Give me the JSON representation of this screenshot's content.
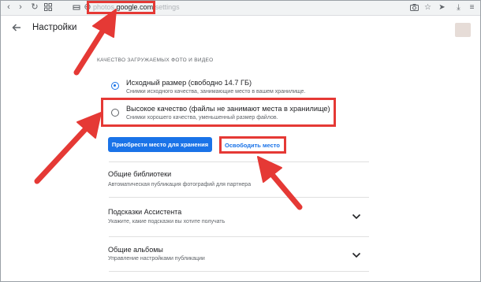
{
  "browser": {
    "url_host_prefix": "photos.",
    "url_domain": "google.com",
    "url_path": "/settings"
  },
  "header": {
    "title": "Настройки"
  },
  "upload_quality": {
    "section_title": "Качество загружаемых фото и видео",
    "options": [
      {
        "label": "Исходный размер (свободно 14.7 ГБ)",
        "description": "Снимки исходного качества, занимающие место в вашем хранилище.",
        "selected": true
      },
      {
        "label": "Высокое качество (файлы не занимают места в хранилище)",
        "description": "Снимки хорошего качества, уменьшенный размер файлов.",
        "selected": false
      }
    ],
    "buy_storage_label": "Приобрести место для хранения",
    "free_up_label": "Освободить место"
  },
  "settings_items": [
    {
      "title": "Общие библиотеки",
      "description": "Автоматическая публикация фотографий для партнера",
      "expandable": false
    },
    {
      "title": "Подсказки Ассистента",
      "description": "Укажите, какие подсказки вы хотите получать",
      "expandable": true
    },
    {
      "title": "Общие альбомы",
      "description": "Управление настройками публикации",
      "expandable": true
    }
  ],
  "colors": {
    "accent": "#1a73e8",
    "annotation_red": "#e53935"
  },
  "icons": [
    "arrow-left-icon",
    "arrow-right-icon",
    "reload-icon",
    "apps-icon",
    "secure-lock-icon",
    "camera-icon",
    "star-icon",
    "send-icon",
    "download-icon",
    "menu-icon",
    "chevron-down-icon",
    "back-arrow-icon"
  ]
}
